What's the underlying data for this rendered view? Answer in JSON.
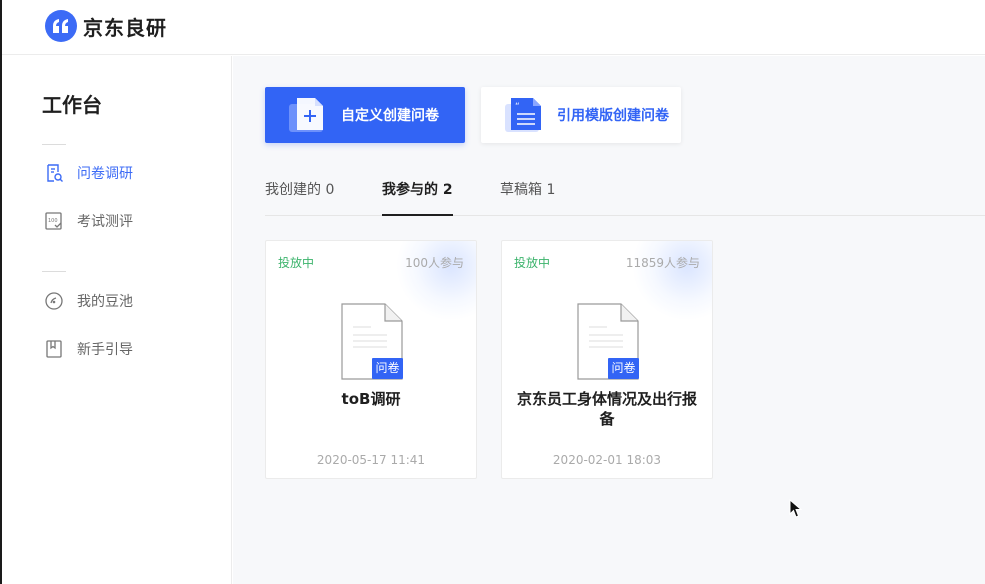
{
  "brand": {
    "name": "京东良研",
    "color": "#3c6bf6",
    "icon": "quote-icon"
  },
  "sidebar": {
    "title": "工作台",
    "groups": [
      [
        {
          "label": "问卷调研",
          "icon": "survey-search-icon",
          "active": true
        },
        {
          "label": "考试测评",
          "icon": "exam-score-icon",
          "active": false
        }
      ],
      [
        {
          "label": "我的豆池",
          "icon": "coin-icon",
          "active": false
        },
        {
          "label": "新手引导",
          "icon": "guide-book-icon",
          "active": false
        }
      ]
    ]
  },
  "actions": {
    "custom_create": {
      "label": "自定义创建问卷",
      "icon": "add-document-icon"
    },
    "template_create": {
      "label": "引用模版创建问卷",
      "icon": "template-document-icon"
    }
  },
  "tabs": [
    {
      "label": "我创建的 0",
      "active": false
    },
    {
      "label": "我参与的 2",
      "active": true
    },
    {
      "label": "草稿箱 1",
      "active": false
    }
  ],
  "cards": [
    {
      "status": "投放中",
      "participants": "100人参与",
      "badge": "问卷",
      "title": "toB调研",
      "date": "2020-05-17 11:41"
    },
    {
      "status": "投放中",
      "participants": "11859人参与",
      "badge": "问卷",
      "title": "京东员工身体情况及出行报备",
      "date": "2020-02-01 18:03"
    }
  ],
  "colors": {
    "accent": "#3264f5",
    "status_green": "#3bb36b",
    "muted": "#aaaaaa"
  }
}
